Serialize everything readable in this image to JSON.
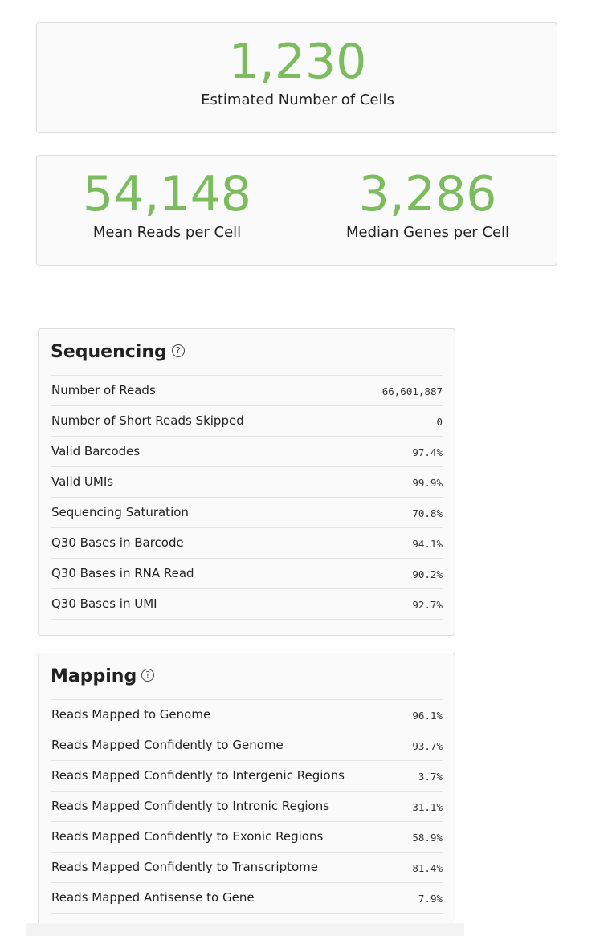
{
  "summary": {
    "cells": {
      "value": "1,230",
      "label": "Estimated Number of Cells"
    },
    "reads": {
      "value": "54,148",
      "label": "Mean Reads per Cell"
    },
    "genes": {
      "value": "3,286",
      "label": "Median Genes per Cell"
    }
  },
  "colors": {
    "accent_green": "#7cbc5e"
  },
  "sequencing": {
    "title": "Sequencing",
    "help_icon": "question-circle-icon",
    "rows": [
      {
        "name": "Number of Reads",
        "value": "66,601,887"
      },
      {
        "name": "Number of Short Reads Skipped",
        "value": "0"
      },
      {
        "name": "Valid Barcodes",
        "value": "97.4%"
      },
      {
        "name": "Valid UMIs",
        "value": "99.9%"
      },
      {
        "name": "Sequencing Saturation",
        "value": "70.8%"
      },
      {
        "name": "Q30 Bases in Barcode",
        "value": "94.1%"
      },
      {
        "name": "Q30 Bases in RNA Read",
        "value": "90.2%"
      },
      {
        "name": "Q30 Bases in UMI",
        "value": "92.7%"
      }
    ]
  },
  "mapping": {
    "title": "Mapping",
    "help_icon": "question-circle-icon",
    "rows": [
      {
        "name": "Reads Mapped to Genome",
        "value": "96.1%"
      },
      {
        "name": "Reads Mapped Confidently to Genome",
        "value": "93.7%"
      },
      {
        "name": "Reads Mapped Confidently to Intergenic Regions",
        "value": "3.7%"
      },
      {
        "name": "Reads Mapped Confidently to Intronic Regions",
        "value": "31.1%"
      },
      {
        "name": "Reads Mapped Confidently to Exonic Regions",
        "value": "58.9%"
      },
      {
        "name": "Reads Mapped Confidently to Transcriptome",
        "value": "81.4%"
      },
      {
        "name": "Reads Mapped Antisense to Gene",
        "value": "7.9%"
      }
    ]
  }
}
